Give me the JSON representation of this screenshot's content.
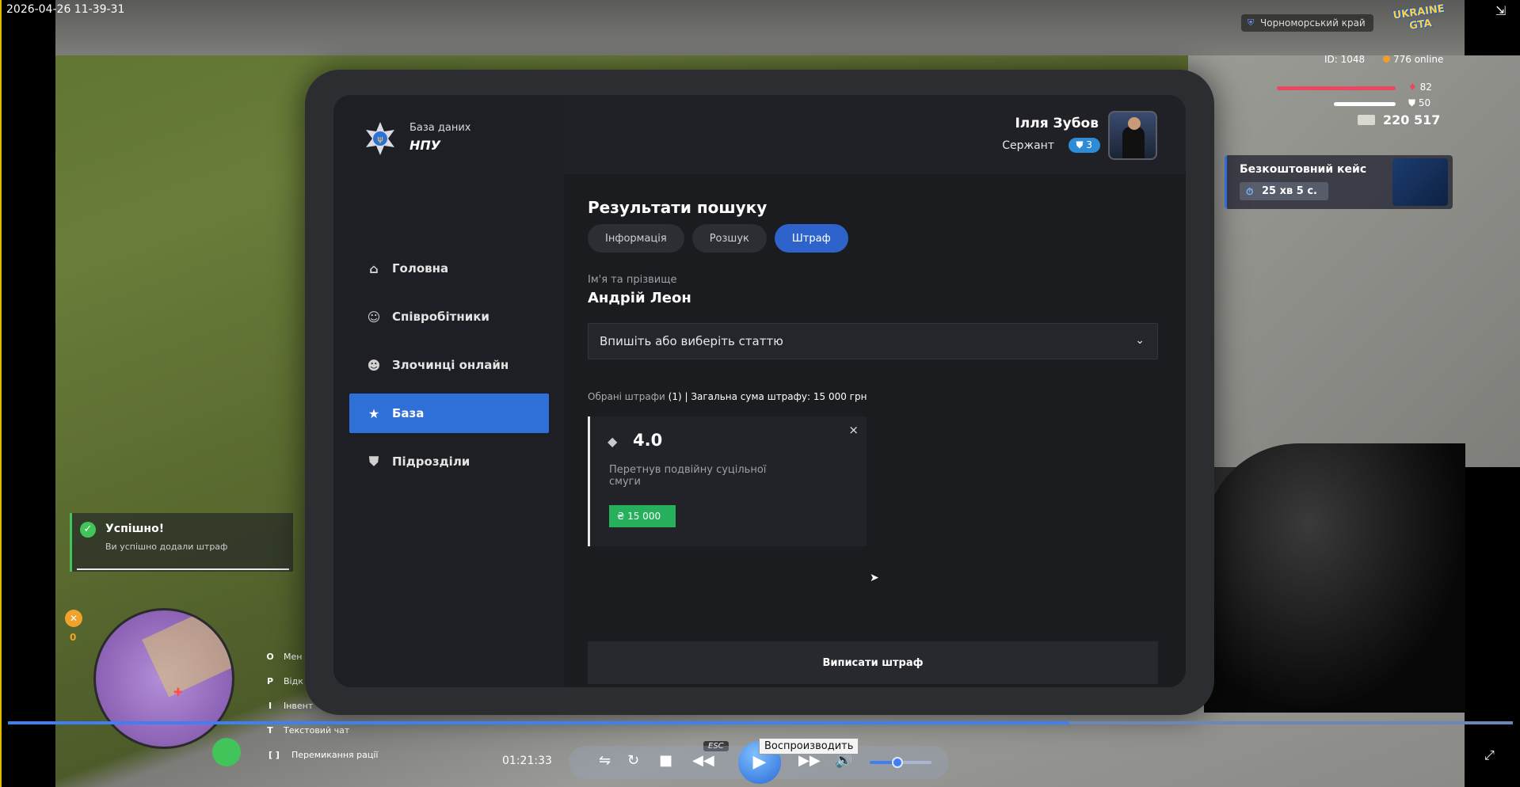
{
  "timestamp": "2026-04-26 11-39-31",
  "hud": {
    "region": "Чорноморський край",
    "game_logo": "UKRAINE GTA",
    "id": "ID: 1048",
    "online": "776 online",
    "health": "82",
    "health_level": 0.82,
    "armor": "50",
    "armor_level": 0.5,
    "money": "220 517",
    "free_case_title": "Безкоштовний кейс",
    "free_case_timer": "25 хв 5 с.",
    "hunger": "0",
    "keys": [
      {
        "key": "O",
        "label": "Мен"
      },
      {
        "key": "P",
        "label": "Відк"
      },
      {
        "key": "I",
        "label": "Інвент"
      },
      {
        "key": "T",
        "label": "Текстовий чат"
      },
      {
        "key": "[ ]",
        "label": "Перемикання рації"
      }
    ]
  },
  "notification": {
    "title": "Успішно!",
    "text": "Ви успішно додали штраф"
  },
  "tablet": {
    "brand_sub": "База даних",
    "brand_main": "НПУ",
    "nav": [
      {
        "label": "Головна",
        "icon": "home-icon"
      },
      {
        "label": "Співробітники",
        "icon": "people-icon"
      },
      {
        "label": "Злочинці онлайн",
        "icon": "mask-icon"
      },
      {
        "label": "База",
        "icon": "star-icon",
        "active": true
      },
      {
        "label": "Підрозділи",
        "icon": "shield-icon"
      }
    ],
    "user": {
      "name": "Ілля Зубов",
      "rank": "Сержант",
      "rank_level": "3"
    },
    "page_title": "Результати пошуку",
    "tabs": [
      {
        "label": "Інформація",
        "active": false
      },
      {
        "label": "Розшук",
        "active": false
      },
      {
        "label": "Штраф",
        "active": true
      }
    ],
    "name_label": "Ім'я та прізвище",
    "person_name": "Андрій Леон",
    "article_select_placeholder": "Впишіть або виберіть статтю",
    "summary_prefix": "Обрані штрафи",
    "summary_count": "(1)",
    "summary_total": "| Загальна сума штрафу: 15 000 грн",
    "fine": {
      "code": "4.0",
      "description": "Перетнув подвійну суцільної смуги",
      "amount": "₴ 15 000",
      "close": "×"
    },
    "submit_label": "Виписати штраф"
  },
  "player": {
    "time": "01:21:33",
    "progress": 0.705,
    "volume": 0.45,
    "tooltip": "Воспроизводить",
    "esc_label": "ESC"
  },
  "colors": {
    "accent": "#2f6fd8",
    "success": "#26b05b",
    "rank_badge": "#2e8bd6",
    "health": "#e9485f"
  }
}
